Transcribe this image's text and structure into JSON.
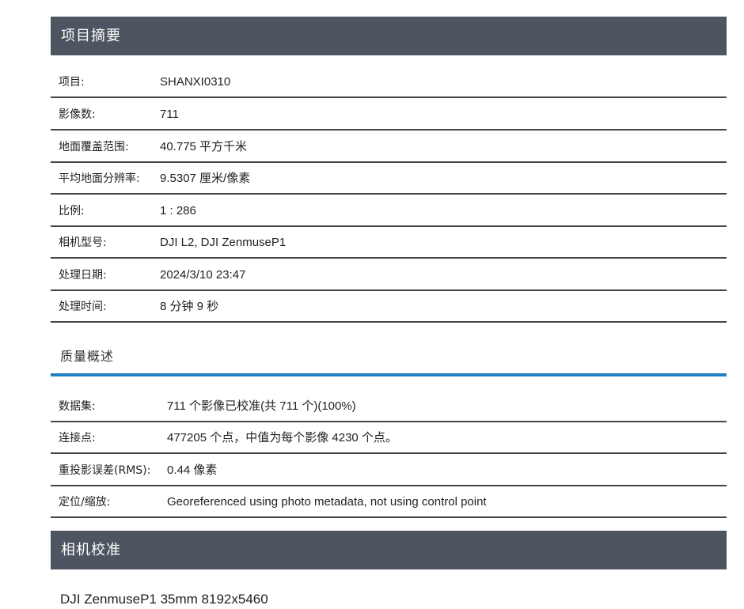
{
  "top_cut": {
    "text": "",
    "icon": "tool-icon"
  },
  "summary": {
    "title": "项目摘要",
    "rows": [
      {
        "label": "项目:",
        "value": "SHANXI0310"
      },
      {
        "label": "影像数:",
        "value": "711"
      },
      {
        "label": "地面覆盖范围:",
        "value": "40.775 平方千米"
      },
      {
        "label": "平均地面分辨率:",
        "value": "9.5307 厘米/像素"
      },
      {
        "label": "比例:",
        "value": "1 : 286"
      },
      {
        "label": "相机型号:",
        "value": "DJI L2, DJI ZenmuseP1"
      },
      {
        "label": "处理日期:",
        "value": "2024/3/10 23:47"
      },
      {
        "label": "处理时间:",
        "value": "8 分钟 9 秒"
      }
    ]
  },
  "quality": {
    "title": "质量概述",
    "rows": [
      {
        "label": "数据集:",
        "value": "711 个影像已校准(共 711 个)(100%)"
      },
      {
        "label": "连接点:",
        "value": "477205 个点，中值为每个影像 4230 个点。"
      },
      {
        "label": "重投影误差(RMS):",
        "value": "0.44 像素"
      },
      {
        "label": "定位/缩放:",
        "value": "Georeferenced using photo metadata, not using control point"
      }
    ]
  },
  "camera_calibration": {
    "title": "相机校准",
    "model": "DJI ZenmuseP1 35mm 8192x5460"
  },
  "colors": {
    "header_bg": "#4c5560",
    "accent_blue": "#1f7fc4",
    "accent_green": "#52b848"
  }
}
